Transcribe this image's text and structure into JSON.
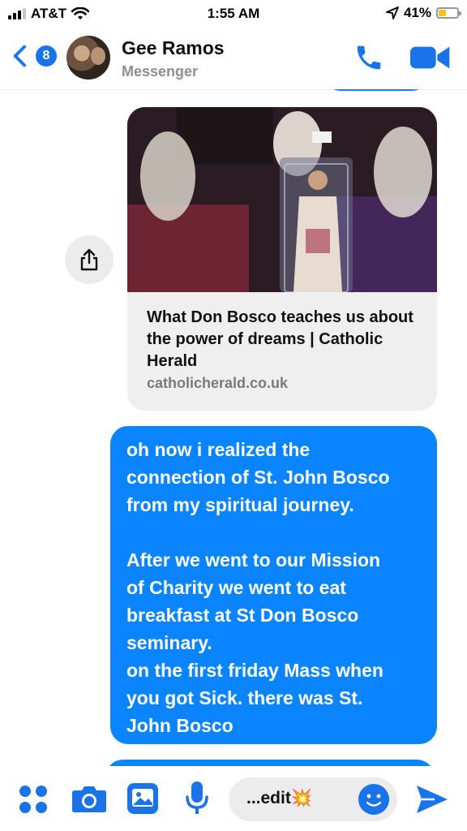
{
  "status_bar": {
    "carrier": "AT&T",
    "time": "1:55 AM",
    "battery_percent": "41%",
    "battery_level": 0.41,
    "battery_color": "#f5c518"
  },
  "header": {
    "back_badge": "8",
    "contact_name": "Gee Ramos",
    "contact_subtitle": "Messenger",
    "accent_color": "#1a73e8",
    "icons": [
      "chevron-left-icon",
      "phone-icon",
      "video-camera-icon"
    ]
  },
  "conversation": {
    "link_card": {
      "title": "What Don Bosco teaches us about the power of dreams | Catholic Herald",
      "domain": "catholicherald.co.uk",
      "share_icon": "share-icon"
    },
    "sent_message": {
      "text": "oh now i realized the\nconnection of St. John Bosco\nfrom my spiritual journey.\n\nAfter we went to our Mission\nof Charity we went to eat\nbreakfast at St Don Bosco\nseminary.\non the first friday Mass when\nyou got Sick. there was St.\nJohn Bosco",
      "bubble_color": "#0a84ff"
    }
  },
  "composer": {
    "input_value": "...edit💥",
    "icons": [
      "apps-grid-icon",
      "camera-icon",
      "photo-gallery-icon",
      "microphone-icon",
      "emoji-icon",
      "send-icon"
    ]
  }
}
